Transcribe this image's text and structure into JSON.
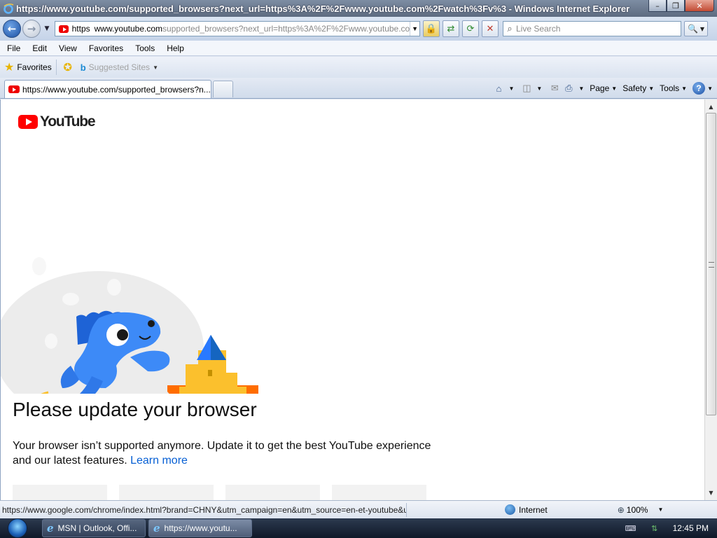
{
  "window": {
    "title": "https://www.youtube.com/supported_browsers?next_url=https%3A%2F%2Fwww.youtube.com%2Fwatch%3Fv%3 - Windows Internet Explorer",
    "minimize": "–",
    "maximize": "❐",
    "close": "✕"
  },
  "address": {
    "scheme": "https",
    "domain": "www.youtube.com",
    "path": "supported_browsers?next_url=https%3A%2F%2Fwww.youtube.co"
  },
  "search": {
    "placeholder": "Live Search"
  },
  "menu": [
    "File",
    "Edit",
    "View",
    "Favorites",
    "Tools",
    "Help"
  ],
  "favorites": {
    "label": "Favorites",
    "suggested": "Suggested Sites"
  },
  "tab": {
    "title": "https://www.youtube.com/supported_browsers?n..."
  },
  "command_bar": {
    "page": "Page",
    "safety": "Safety",
    "tools": "Tools"
  },
  "content": {
    "logo_text": "YouTube",
    "headline": "Please update your browser",
    "message": "Your browser isn’t supported anymore. Update it to get the best YouTube experience and our latest features.",
    "learn_more": "Learn more"
  },
  "status": {
    "url": "https://www.google.com/chrome/index.html?brand=CHNY&utm_campaign=en&utm_source=en-et-youtube&u",
    "zone": "Internet",
    "zoom": "100%"
  },
  "taskbar": {
    "items": [
      "MSN | Outlook, Offi...",
      "https://www.youtu..."
    ],
    "clock": "12:45 PM"
  },
  "colors": {
    "youtube_red": "#ff0000",
    "link_blue": "#065fd4",
    "dino_blue": "#3d8af7",
    "platform_orange": "#ff6d00",
    "castle_yellow": "#fbc02d"
  }
}
